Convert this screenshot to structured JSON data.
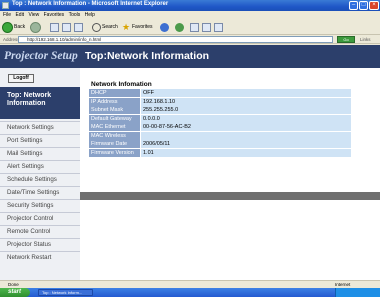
{
  "window": {
    "title": "Top : Network Information - Microsoft Internet Explorer"
  },
  "menubar": [
    "File",
    "Edit",
    "View",
    "Favorites",
    "Tools",
    "Help"
  ],
  "toolbar": {
    "back_label": "Back",
    "search_label": "Search",
    "favorites_label": "Favorites"
  },
  "addressbar": {
    "label": "Address",
    "url": "http://192.168.1.10/admin/info_n.html",
    "go_label": "Go",
    "links_label": "Links"
  },
  "sidebar": {
    "logo": "Projector Setup",
    "logoff_label": "Logoff",
    "active": "Top: Network Information",
    "items": [
      "Network Settings",
      "Port Settings",
      "Mail Settings",
      "Alert Settings",
      "Schedule Settings",
      "Date/Time Settings",
      "Security Settings",
      "Projector Control",
      "Remote Control",
      "Projector Status",
      "Network Restart"
    ]
  },
  "content": {
    "header": "Top:Network Information",
    "section_title": "Network Infomation",
    "rows": [
      {
        "key": "DHCP",
        "value": "OFF"
      },
      {
        "key": "IP Address",
        "value": "192.168.1.10"
      },
      {
        "key": "Subnet Mask",
        "value": "255.255.255.0"
      },
      {
        "key": "Default Gateway",
        "value": "0.0.0.0"
      },
      {
        "key": "MAC Ethernet",
        "value": "00-00-87-56-AC-B2"
      },
      {
        "key": "MAC Wireless",
        "value": ""
      },
      {
        "key": "Firmware Date",
        "value": "2006/05/11"
      },
      {
        "key": "Firmware Version",
        "value": "1.01"
      }
    ]
  },
  "statusbar": {
    "left": "Done",
    "right": "Internet"
  },
  "taskbar": {
    "start_label": "start",
    "task_label": "Top : Network Inform..."
  },
  "colors": {
    "nav_dark": "#2c3f6b",
    "key_cell": "#8aa2c8",
    "value_cell": "#cfe3f5"
  }
}
